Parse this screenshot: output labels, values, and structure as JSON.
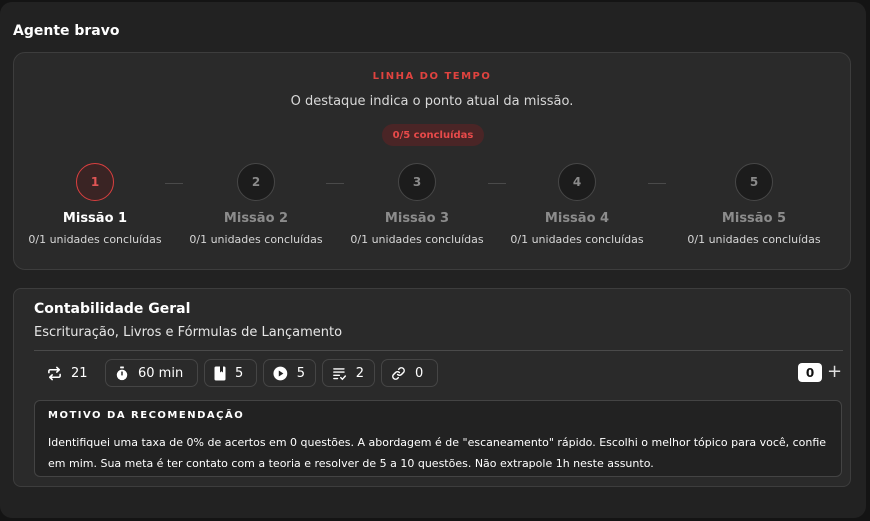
{
  "app": {
    "title": "Agente bravo"
  },
  "timeline": {
    "label": "LINHA DO TEMPO",
    "subtitle": "O destaque indica o ponto atual da missão.",
    "progress_badge": "0/5 concluídas",
    "accent_color": "#e0433f",
    "steps": [
      {
        "number": "1",
        "name": "Missão 1",
        "units": "0/1 unidades concluídas",
        "active": true
      },
      {
        "number": "2",
        "name": "Missão 2",
        "units": "0/1 unidades concluídas",
        "active": false
      },
      {
        "number": "3",
        "name": "Missão 3",
        "units": "0/1 unidades concluídas",
        "active": false
      },
      {
        "number": "4",
        "name": "Missão 4",
        "units": "0/1 unidades concluídas",
        "active": false
      },
      {
        "number": "5",
        "name": "Missão 5",
        "units": "0/1 unidades concluídas",
        "active": false
      }
    ]
  },
  "card": {
    "title": "Contabilidade Geral",
    "subtitle": "Escrituração, Livros e Fórmulas de Lançamento",
    "stats": [
      {
        "icon": "repeat-icon",
        "value": "21"
      },
      {
        "icon": "stopwatch-icon",
        "value": "60 min"
      },
      {
        "icon": "book-icon",
        "value": "5"
      },
      {
        "icon": "play-icon",
        "value": "5"
      },
      {
        "icon": "checklist-icon",
        "value": "2"
      },
      {
        "icon": "link-icon",
        "value": "0"
      }
    ],
    "counter": "0",
    "add_symbol": "+",
    "reason": {
      "title": "MOTIVO DA RECOMENDAÇÃO",
      "text": "Identifiquei uma taxa de 0% de acertos em 0 questões. A abordagem é de \"escaneamento\" rápido. Escolhi o melhor tópico para você, confie em mim. Sua meta é ter contato com a teoria e resolver de 5 a 10 questões. Não extrapole 1h neste assunto."
    }
  }
}
